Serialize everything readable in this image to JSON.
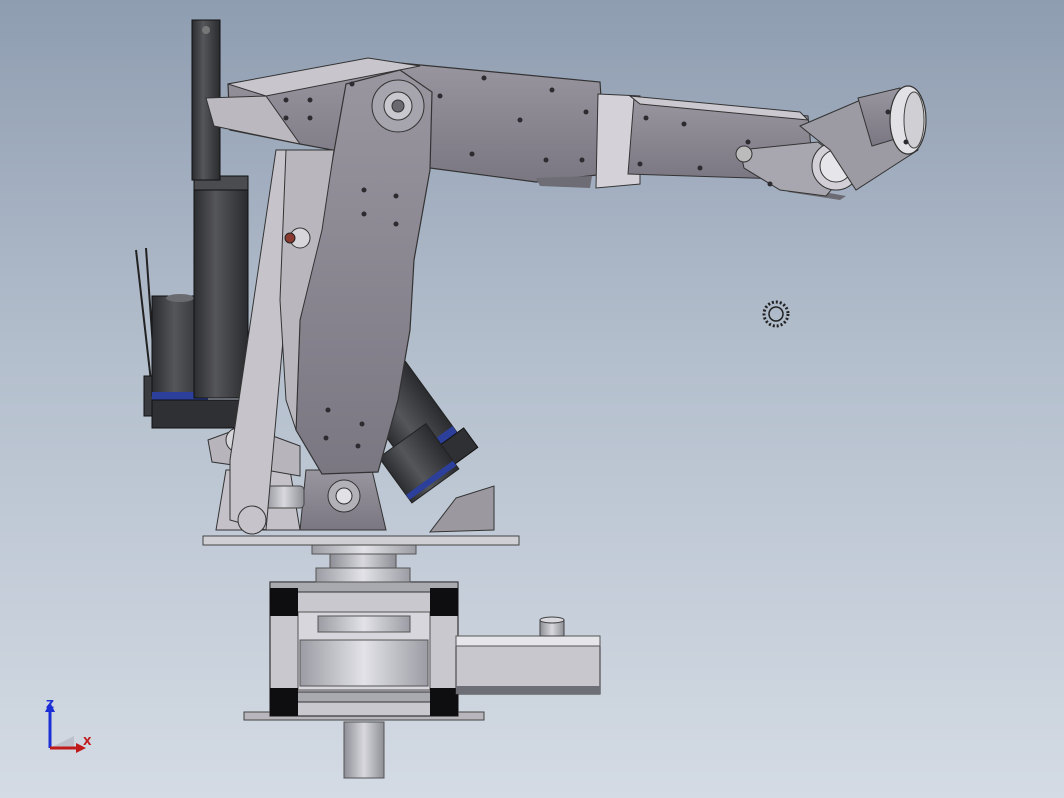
{
  "viewport": {
    "background_top": "#8f9db1",
    "background_bottom": "#d4dbe4"
  },
  "model": {
    "name": "",
    "part_color": "#8a8690",
    "highlight_color": "#c6c6cc",
    "motor_color": "#3a3b3e",
    "accent_ring_color": "#2b3f9b"
  },
  "triad": {
    "z_label": "Z",
    "x_label": "X",
    "z_color": "#1c2fd6",
    "x_color": "#c11a1a"
  }
}
